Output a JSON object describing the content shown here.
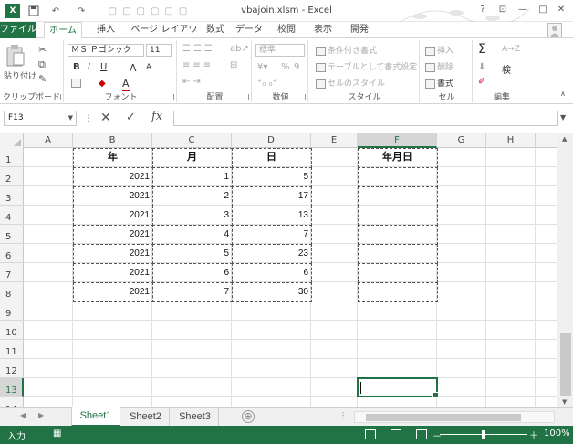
{
  "app": {
    "window_title": "vbajoin.xlsm - Excel",
    "accent_color": "#217346",
    "window_controls": {
      "help": "?",
      "ribbon_display": "⊡",
      "minimize": "—",
      "restore": "□",
      "close": "✕"
    }
  },
  "quick_access": {
    "app_icon": "X",
    "save_icon": "save-icon",
    "undo_icon": "undo-icon",
    "redo_icon": "redo-icon"
  },
  "tabs": [
    {
      "label": "ファイル"
    },
    {
      "label": "ホーム"
    },
    {
      "label": "挿入"
    },
    {
      "label": "ページ レイアウト"
    },
    {
      "label": "数式"
    },
    {
      "label": "データ"
    },
    {
      "label": "校閲"
    },
    {
      "label": "表示"
    },
    {
      "label": "開発"
    }
  ],
  "ribbon": {
    "clipboard": {
      "paste": "貼り付け",
      "label": "クリップボード"
    },
    "font": {
      "name": "ＭＳ Ｐゴシック",
      "size": "11",
      "bold": "B",
      "italic": "I",
      "underline": "U",
      "grow": "A",
      "shrink": "A",
      "color_a": "A",
      "label": "フォント"
    },
    "alignment": {
      "label": "配置"
    },
    "number": {
      "format": "標準",
      "percent": "%",
      "comma": "9",
      "label": "数値"
    },
    "styles": {
      "conditional": "条件付き書式",
      "table": "テーブルとして書式設定",
      "cell_styles": "セルのスタイル",
      "label": "スタイル"
    },
    "cells": {
      "insert": "挿入",
      "delete": "削除",
      "format": "書式",
      "label": "セル"
    },
    "editing": {
      "sum": "Σ",
      "sort": "A→Z",
      "find": "検",
      "clear": "✐",
      "label": "編集"
    }
  },
  "formula_bar": {
    "name_box": "F13",
    "cancel": "✕",
    "enter": "✓",
    "fx": "fx",
    "value": ""
  },
  "columns": [
    "A",
    "B",
    "C",
    "D",
    "E",
    "F",
    "G",
    "H"
  ],
  "rows": [
    "1",
    "2",
    "3",
    "4",
    "5",
    "6",
    "7",
    "8",
    "9",
    "10",
    "11",
    "12",
    "13",
    "14"
  ],
  "table": {
    "headers": [
      "年",
      "月",
      "日",
      "年月日"
    ],
    "rows": [
      [
        "2021",
        "1",
        "5",
        ""
      ],
      [
        "2021",
        "2",
        "17",
        ""
      ],
      [
        "2021",
        "3",
        "13",
        ""
      ],
      [
        "2021",
        "4",
        "7",
        ""
      ],
      [
        "2021",
        "5",
        "23",
        ""
      ],
      [
        "2021",
        "6",
        "6",
        ""
      ],
      [
        "2021",
        "7",
        "30",
        ""
      ]
    ]
  },
  "active_cell": "F13",
  "sheets": [
    {
      "label": "Sheet1",
      "active": true
    },
    {
      "label": "Sheet2",
      "active": false
    },
    {
      "label": "Sheet3",
      "active": false
    }
  ],
  "add_sheet": "⊕",
  "status": {
    "mode": "入力",
    "macro_icon": "macro-record-icon",
    "zoom": "100%",
    "zoom_minus": "－",
    "zoom_plus": "＋"
  }
}
